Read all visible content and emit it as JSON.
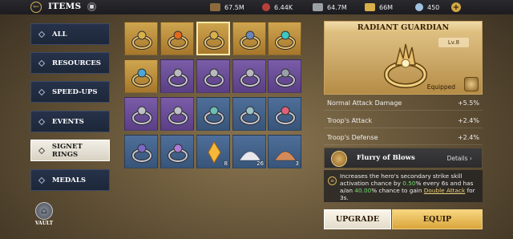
{
  "topbar": {
    "title": "ITEMS",
    "resources": [
      {
        "name": "wood",
        "value": "67.5M",
        "color": "#8b6b3e"
      },
      {
        "name": "meat",
        "value": "6.44K",
        "color": "#b8403a"
      },
      {
        "name": "stone",
        "value": "64.7M",
        "color": "#9aa0a6"
      },
      {
        "name": "gold",
        "value": "66M",
        "color": "#d8b04a"
      },
      {
        "name": "gems",
        "value": "450",
        "color": "#9ec2e0"
      }
    ]
  },
  "sidebar": {
    "items": [
      {
        "label": "ALL"
      },
      {
        "label": "RESOURCES"
      },
      {
        "label": "SPEED-UPS"
      },
      {
        "label": "EVENTS"
      },
      {
        "label": "SIGNET RINGS"
      },
      {
        "label": "MEDALS"
      }
    ],
    "active_index": 4,
    "vault_label": "VAULT"
  },
  "grid": {
    "cells": [
      {
        "bg": "gold",
        "kind": "ring",
        "gem": "#d8b04a"
      },
      {
        "bg": "gold",
        "kind": "ring",
        "gem": "#e06a1a"
      },
      {
        "bg": "gold",
        "kind": "ring",
        "gem": "#d8b04a",
        "selected": true
      },
      {
        "bg": "gold",
        "kind": "ring",
        "gem": "#6a86b8"
      },
      {
        "bg": "gold",
        "kind": "ring",
        "gem": "#3ec6c2"
      },
      {
        "bg": "gold",
        "kind": "ring",
        "gem": "#4aa7d8"
      },
      {
        "bg": "purple",
        "kind": "ring",
        "gem": "#b8b8c0"
      },
      {
        "bg": "purple",
        "kind": "ring",
        "gem": "#b8b8c0"
      },
      {
        "bg": "purple",
        "kind": "ring",
        "gem": "#b8b8c0"
      },
      {
        "bg": "purple",
        "kind": "ring",
        "gem": "#9aa0aa"
      },
      {
        "bg": "purple",
        "kind": "ring",
        "gem": "#c0c0c8"
      },
      {
        "bg": "purple",
        "kind": "ring",
        "gem": "#c0c0c8"
      },
      {
        "bg": "blue",
        "kind": "ring",
        "gem": "#6bbfb5"
      },
      {
        "bg": "blue",
        "kind": "ring",
        "gem": "#9ac0c8"
      },
      {
        "bg": "blue",
        "kind": "ring",
        "gem": "#e0607a"
      },
      {
        "bg": "blue",
        "kind": "ring",
        "gem": "#7a68c8"
      },
      {
        "bg": "blue",
        "kind": "ring",
        "gem": "#b07ad8"
      },
      {
        "bg": "blue",
        "kind": "crystal",
        "qty": "8"
      },
      {
        "bg": "blue",
        "kind": "powder",
        "color": "#e8e8ee",
        "qty": "26"
      },
      {
        "bg": "blue",
        "kind": "powder",
        "color": "#d48a5a",
        "qty": "3"
      }
    ]
  },
  "detail": {
    "name": "RADIANT GUARDIAN",
    "level": "Lv.8",
    "equipped_label": "Equipped",
    "stats": [
      {
        "label": "Normal Attack Damage",
        "value": "+5.5%"
      },
      {
        "label": "Troop's Attack",
        "value": "+2.4%"
      },
      {
        "label": "Troop's Defense",
        "value": "+2.4%"
      }
    ],
    "skill": {
      "name": "Flurry of Blows",
      "details_label": "Details"
    },
    "description": {
      "p1": "Increases the hero's secondary strike skill activation chance by ",
      "v1": "0.50",
      "p2": "% every 6s and has a/an ",
      "v2": "40.00",
      "p3": "% chance to gain ",
      "link": "Double Attack",
      "p4": " for 3s."
    },
    "buttons": {
      "upgrade": "UPGRADE",
      "equip": "EQUIP"
    }
  }
}
